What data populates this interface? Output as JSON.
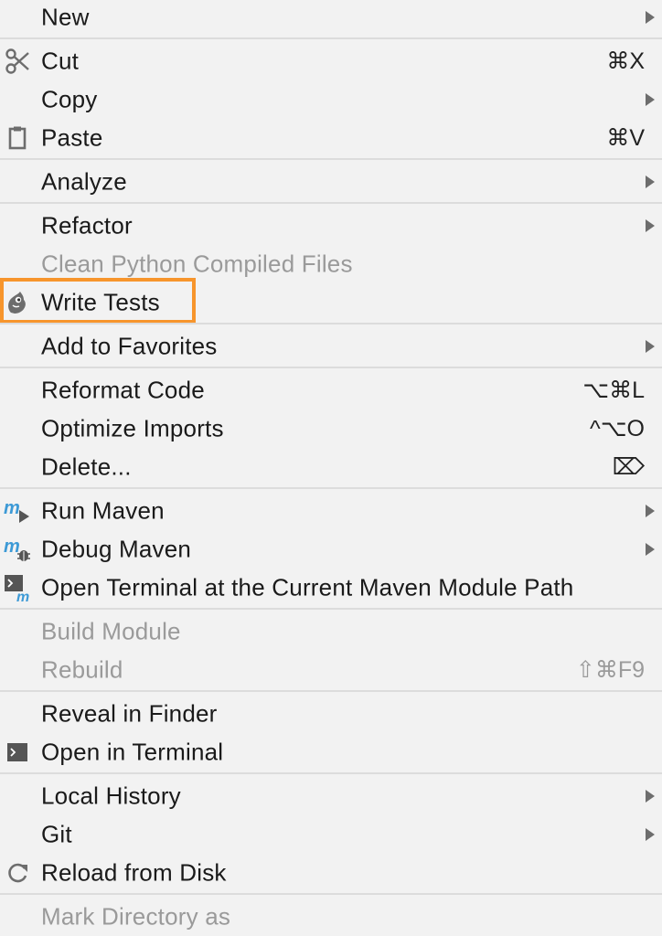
{
  "menu": {
    "new": {
      "label": "New"
    },
    "cut": {
      "label": "Cut",
      "shortcut": "⌘X"
    },
    "copy": {
      "label": "Copy"
    },
    "paste": {
      "label": "Paste",
      "shortcut": "⌘V"
    },
    "analyze": {
      "label": "Analyze"
    },
    "refactor": {
      "label": "Refactor"
    },
    "clean_python": {
      "label": "Clean Python Compiled Files"
    },
    "write_tests": {
      "label": "Write Tests"
    },
    "add_favorites": {
      "label": "Add to Favorites"
    },
    "reformat": {
      "label": "Reformat Code",
      "shortcut": "⌥⌘L"
    },
    "optimize": {
      "label": "Optimize Imports",
      "shortcut": "^⌥O"
    },
    "delete": {
      "label": "Delete...",
      "shortcut": "⌦"
    },
    "run_maven": {
      "label": "Run Maven"
    },
    "debug_maven": {
      "label": "Debug Maven"
    },
    "open_terminal_maven": {
      "label": "Open Terminal at the Current Maven Module Path"
    },
    "build_module": {
      "label": "Build Module"
    },
    "rebuild": {
      "label": "Rebuild",
      "shortcut": "⇧⌘F9"
    },
    "reveal_finder": {
      "label": "Reveal in Finder"
    },
    "open_terminal": {
      "label": "Open in Terminal"
    },
    "local_history": {
      "label": "Local History"
    },
    "git": {
      "label": "Git"
    },
    "reload": {
      "label": "Reload from Disk"
    },
    "mark_directory": {
      "label": "Mark Directory as"
    }
  },
  "colors": {
    "background": "#f2f2f2",
    "separator": "#dcdcdc",
    "disabled_text": "#9a9a9a",
    "highlight_border": "#f7952c",
    "maven_blue": "#3d9ad6"
  },
  "icons": {
    "cut": "scissors-icon",
    "paste": "clipboard-icon",
    "write_tests": "squirrel-icon",
    "run_maven": "maven-run-icon",
    "debug_maven": "maven-debug-icon",
    "open_terminal_maven": "maven-terminal-icon",
    "open_terminal": "terminal-icon",
    "reload": "reload-icon",
    "delete_shortcut": "delete-forward-icon"
  }
}
